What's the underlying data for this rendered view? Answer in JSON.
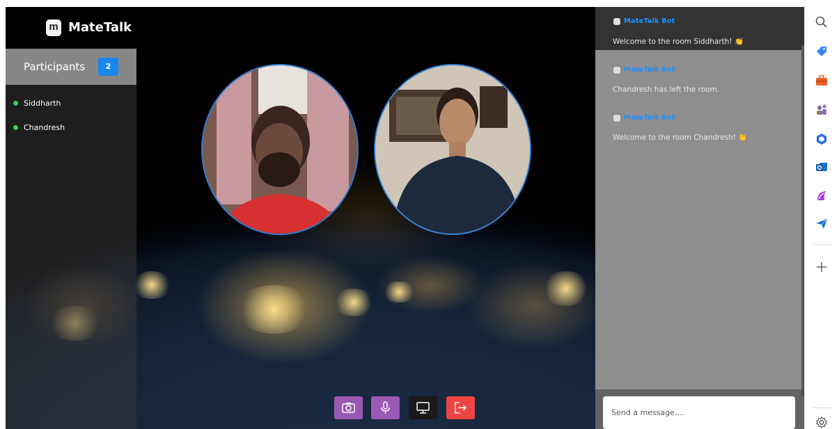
{
  "app": {
    "name": "MateTalk",
    "logo_letter": "m"
  },
  "participants": {
    "title": "Participants",
    "count": "2",
    "list": [
      {
        "name": "Siddharth",
        "status_color": "#3ad15a"
      },
      {
        "name": "Chandresh",
        "status_color": "#3ad15a"
      }
    ]
  },
  "chat": {
    "messages": [
      {
        "sender": "MateTalk Bot",
        "text": "Welcome to the room Siddharth! 👏"
      },
      {
        "sender": "MateTalk Bot",
        "text": "Chandresh has left the room."
      },
      {
        "sender": "MateTalk Bot",
        "text": "Welcome to the room Chandresh! 👏"
      }
    ],
    "input_placeholder": "Send a message...."
  },
  "controls": [
    {
      "name": "camera",
      "icon": "camera-icon",
      "color": "#9b59b6"
    },
    {
      "name": "microphone",
      "icon": "microphone-icon",
      "color": "#9b59b6"
    },
    {
      "name": "screen-share",
      "icon": "monitor-icon",
      "color": "#1a1a1a"
    },
    {
      "name": "leave",
      "icon": "exit-icon",
      "color": "#ef4444"
    }
  ],
  "browser_sidebar": {
    "icons": [
      "search-icon",
      "tag-icon",
      "briefcase-icon",
      "people-icon",
      "office-icon",
      "outlook-icon",
      "power-automate-icon",
      "send-icon",
      "add-icon",
      "settings-icon"
    ]
  },
  "colors": {
    "accent": "#1a86f0",
    "online": "#3ad15a",
    "bot_name": "#1e90ff",
    "control_purple": "#9b59b6",
    "leave_red": "#ef4444"
  }
}
